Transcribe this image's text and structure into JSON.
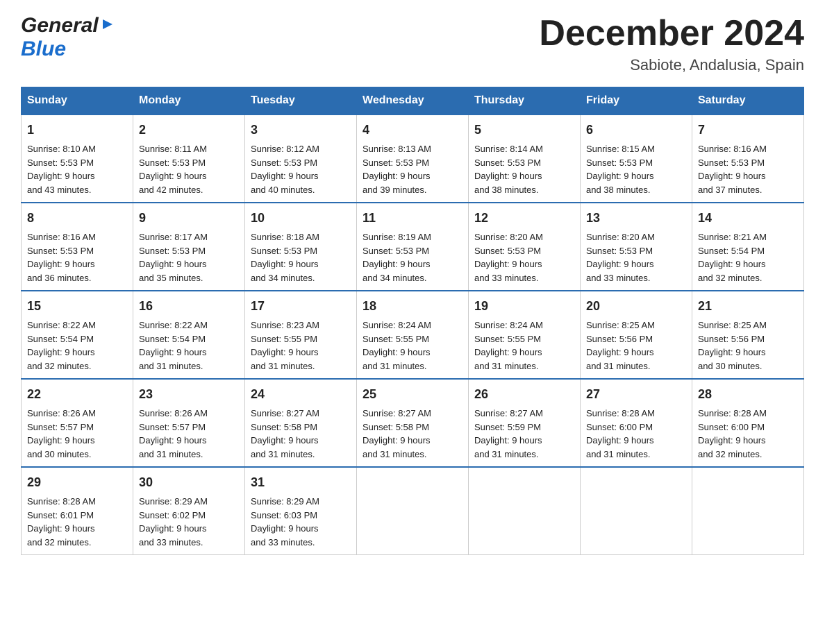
{
  "header": {
    "logo_general": "General",
    "logo_blue": "Blue",
    "month_title": "December 2024",
    "location": "Sabiote, Andalusia, Spain"
  },
  "days_of_week": [
    "Sunday",
    "Monday",
    "Tuesday",
    "Wednesday",
    "Thursday",
    "Friday",
    "Saturday"
  ],
  "weeks": [
    [
      {
        "day": "1",
        "sunrise": "8:10 AM",
        "sunset": "5:53 PM",
        "daylight": "9 hours and 43 minutes."
      },
      {
        "day": "2",
        "sunrise": "8:11 AM",
        "sunset": "5:53 PM",
        "daylight": "9 hours and 42 minutes."
      },
      {
        "day": "3",
        "sunrise": "8:12 AM",
        "sunset": "5:53 PM",
        "daylight": "9 hours and 40 minutes."
      },
      {
        "day": "4",
        "sunrise": "8:13 AM",
        "sunset": "5:53 PM",
        "daylight": "9 hours and 39 minutes."
      },
      {
        "day": "5",
        "sunrise": "8:14 AM",
        "sunset": "5:53 PM",
        "daylight": "9 hours and 38 minutes."
      },
      {
        "day": "6",
        "sunrise": "8:15 AM",
        "sunset": "5:53 PM",
        "daylight": "9 hours and 38 minutes."
      },
      {
        "day": "7",
        "sunrise": "8:16 AM",
        "sunset": "5:53 PM",
        "daylight": "9 hours and 37 minutes."
      }
    ],
    [
      {
        "day": "8",
        "sunrise": "8:16 AM",
        "sunset": "5:53 PM",
        "daylight": "9 hours and 36 minutes."
      },
      {
        "day": "9",
        "sunrise": "8:17 AM",
        "sunset": "5:53 PM",
        "daylight": "9 hours and 35 minutes."
      },
      {
        "day": "10",
        "sunrise": "8:18 AM",
        "sunset": "5:53 PM",
        "daylight": "9 hours and 34 minutes."
      },
      {
        "day": "11",
        "sunrise": "8:19 AM",
        "sunset": "5:53 PM",
        "daylight": "9 hours and 34 minutes."
      },
      {
        "day": "12",
        "sunrise": "8:20 AM",
        "sunset": "5:53 PM",
        "daylight": "9 hours and 33 minutes."
      },
      {
        "day": "13",
        "sunrise": "8:20 AM",
        "sunset": "5:53 PM",
        "daylight": "9 hours and 33 minutes."
      },
      {
        "day": "14",
        "sunrise": "8:21 AM",
        "sunset": "5:54 PM",
        "daylight": "9 hours and 32 minutes."
      }
    ],
    [
      {
        "day": "15",
        "sunrise": "8:22 AM",
        "sunset": "5:54 PM",
        "daylight": "9 hours and 32 minutes."
      },
      {
        "day": "16",
        "sunrise": "8:22 AM",
        "sunset": "5:54 PM",
        "daylight": "9 hours and 31 minutes."
      },
      {
        "day": "17",
        "sunrise": "8:23 AM",
        "sunset": "5:55 PM",
        "daylight": "9 hours and 31 minutes."
      },
      {
        "day": "18",
        "sunrise": "8:24 AM",
        "sunset": "5:55 PM",
        "daylight": "9 hours and 31 minutes."
      },
      {
        "day": "19",
        "sunrise": "8:24 AM",
        "sunset": "5:55 PM",
        "daylight": "9 hours and 31 minutes."
      },
      {
        "day": "20",
        "sunrise": "8:25 AM",
        "sunset": "5:56 PM",
        "daylight": "9 hours and 31 minutes."
      },
      {
        "day": "21",
        "sunrise": "8:25 AM",
        "sunset": "5:56 PM",
        "daylight": "9 hours and 30 minutes."
      }
    ],
    [
      {
        "day": "22",
        "sunrise": "8:26 AM",
        "sunset": "5:57 PM",
        "daylight": "9 hours and 30 minutes."
      },
      {
        "day": "23",
        "sunrise": "8:26 AM",
        "sunset": "5:57 PM",
        "daylight": "9 hours and 31 minutes."
      },
      {
        "day": "24",
        "sunrise": "8:27 AM",
        "sunset": "5:58 PM",
        "daylight": "9 hours and 31 minutes."
      },
      {
        "day": "25",
        "sunrise": "8:27 AM",
        "sunset": "5:58 PM",
        "daylight": "9 hours and 31 minutes."
      },
      {
        "day": "26",
        "sunrise": "8:27 AM",
        "sunset": "5:59 PM",
        "daylight": "9 hours and 31 minutes."
      },
      {
        "day": "27",
        "sunrise": "8:28 AM",
        "sunset": "6:00 PM",
        "daylight": "9 hours and 31 minutes."
      },
      {
        "day": "28",
        "sunrise": "8:28 AM",
        "sunset": "6:00 PM",
        "daylight": "9 hours and 32 minutes."
      }
    ],
    [
      {
        "day": "29",
        "sunrise": "8:28 AM",
        "sunset": "6:01 PM",
        "daylight": "9 hours and 32 minutes."
      },
      {
        "day": "30",
        "sunrise": "8:29 AM",
        "sunset": "6:02 PM",
        "daylight": "9 hours and 33 minutes."
      },
      {
        "day": "31",
        "sunrise": "8:29 AM",
        "sunset": "6:03 PM",
        "daylight": "9 hours and 33 minutes."
      },
      null,
      null,
      null,
      null
    ]
  ],
  "labels": {
    "sunrise": "Sunrise:",
    "sunset": "Sunset:",
    "daylight": "Daylight:"
  }
}
